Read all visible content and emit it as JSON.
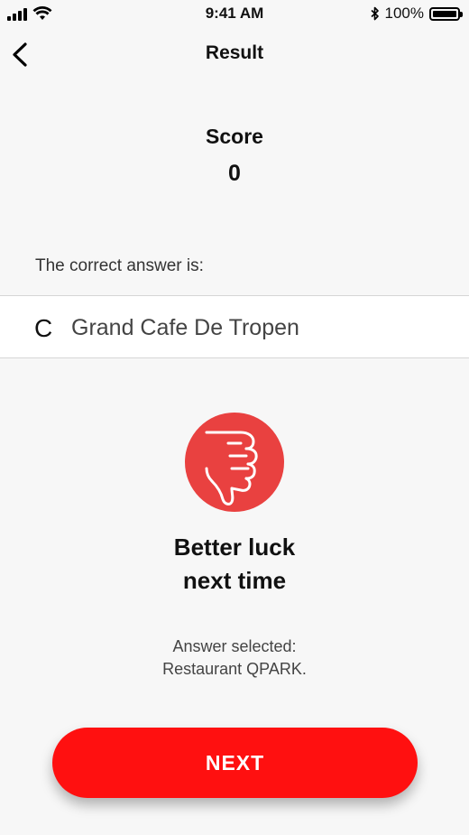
{
  "status_bar": {
    "time": "9:41 AM",
    "battery_text": "100%",
    "icons": [
      "signal-icon",
      "wifi-icon",
      "bluetooth-icon",
      "battery-icon"
    ]
  },
  "header": {
    "title": "Result",
    "back_icon": "chevron-left-icon"
  },
  "score": {
    "label": "Score",
    "value": "0"
  },
  "correct_answer": {
    "label": "The correct answer is:",
    "letter": "C",
    "text": "Grand Cafe De Tropen"
  },
  "feedback": {
    "icon": "thumbs-down-icon",
    "icon_color": "#e94140",
    "line1": "Better luck",
    "line2": "next time",
    "selected_line1": "Answer selected:",
    "selected_line2": "Restaurant QPARK."
  },
  "actions": {
    "next_label": "NEXT",
    "accent_color": "#ff1010"
  }
}
